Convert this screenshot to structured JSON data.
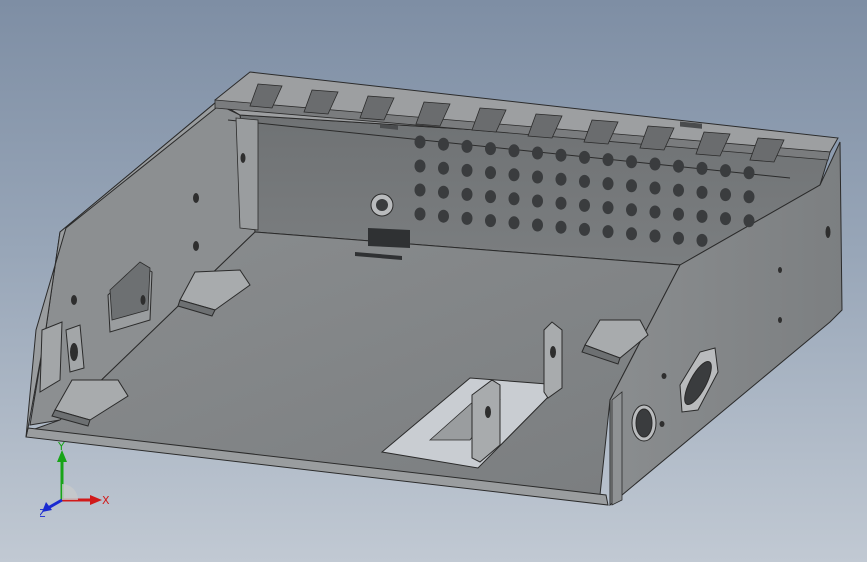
{
  "viewport": {
    "part_color": "#7f8284",
    "background_top": "#7e8ea4",
    "background_bottom": "#c1c9d3"
  },
  "triad": {
    "x_label": "X",
    "y_label": "Y",
    "z_label": "Z",
    "x_color": "#d11a1a",
    "y_color": "#18a418",
    "z_color": "#1a2ad1"
  }
}
